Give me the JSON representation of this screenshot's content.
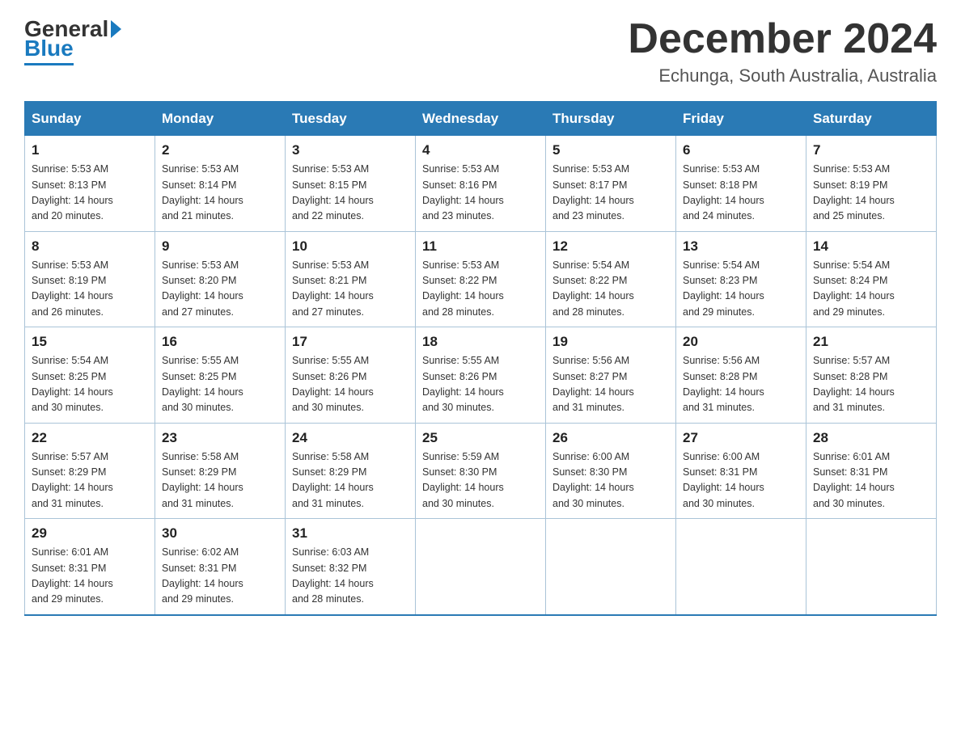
{
  "header": {
    "logo_general": "General",
    "logo_blue": "Blue",
    "month_title": "December 2024",
    "location": "Echunga, South Australia, Australia"
  },
  "weekdays": [
    "Sunday",
    "Monday",
    "Tuesday",
    "Wednesday",
    "Thursday",
    "Friday",
    "Saturday"
  ],
  "weeks": [
    [
      {
        "num": "1",
        "sunrise": "5:53 AM",
        "sunset": "8:13 PM",
        "daylight": "14 hours and 20 minutes."
      },
      {
        "num": "2",
        "sunrise": "5:53 AM",
        "sunset": "8:14 PM",
        "daylight": "14 hours and 21 minutes."
      },
      {
        "num": "3",
        "sunrise": "5:53 AM",
        "sunset": "8:15 PM",
        "daylight": "14 hours and 22 minutes."
      },
      {
        "num": "4",
        "sunrise": "5:53 AM",
        "sunset": "8:16 PM",
        "daylight": "14 hours and 23 minutes."
      },
      {
        "num": "5",
        "sunrise": "5:53 AM",
        "sunset": "8:17 PM",
        "daylight": "14 hours and 23 minutes."
      },
      {
        "num": "6",
        "sunrise": "5:53 AM",
        "sunset": "8:18 PM",
        "daylight": "14 hours and 24 minutes."
      },
      {
        "num": "7",
        "sunrise": "5:53 AM",
        "sunset": "8:19 PM",
        "daylight": "14 hours and 25 minutes."
      }
    ],
    [
      {
        "num": "8",
        "sunrise": "5:53 AM",
        "sunset": "8:19 PM",
        "daylight": "14 hours and 26 minutes."
      },
      {
        "num": "9",
        "sunrise": "5:53 AM",
        "sunset": "8:20 PM",
        "daylight": "14 hours and 27 minutes."
      },
      {
        "num": "10",
        "sunrise": "5:53 AM",
        "sunset": "8:21 PM",
        "daylight": "14 hours and 27 minutes."
      },
      {
        "num": "11",
        "sunrise": "5:53 AM",
        "sunset": "8:22 PM",
        "daylight": "14 hours and 28 minutes."
      },
      {
        "num": "12",
        "sunrise": "5:54 AM",
        "sunset": "8:22 PM",
        "daylight": "14 hours and 28 minutes."
      },
      {
        "num": "13",
        "sunrise": "5:54 AM",
        "sunset": "8:23 PM",
        "daylight": "14 hours and 29 minutes."
      },
      {
        "num": "14",
        "sunrise": "5:54 AM",
        "sunset": "8:24 PM",
        "daylight": "14 hours and 29 minutes."
      }
    ],
    [
      {
        "num": "15",
        "sunrise": "5:54 AM",
        "sunset": "8:25 PM",
        "daylight": "14 hours and 30 minutes."
      },
      {
        "num": "16",
        "sunrise": "5:55 AM",
        "sunset": "8:25 PM",
        "daylight": "14 hours and 30 minutes."
      },
      {
        "num": "17",
        "sunrise": "5:55 AM",
        "sunset": "8:26 PM",
        "daylight": "14 hours and 30 minutes."
      },
      {
        "num": "18",
        "sunrise": "5:55 AM",
        "sunset": "8:26 PM",
        "daylight": "14 hours and 30 minutes."
      },
      {
        "num": "19",
        "sunrise": "5:56 AM",
        "sunset": "8:27 PM",
        "daylight": "14 hours and 31 minutes."
      },
      {
        "num": "20",
        "sunrise": "5:56 AM",
        "sunset": "8:28 PM",
        "daylight": "14 hours and 31 minutes."
      },
      {
        "num": "21",
        "sunrise": "5:57 AM",
        "sunset": "8:28 PM",
        "daylight": "14 hours and 31 minutes."
      }
    ],
    [
      {
        "num": "22",
        "sunrise": "5:57 AM",
        "sunset": "8:29 PM",
        "daylight": "14 hours and 31 minutes."
      },
      {
        "num": "23",
        "sunrise": "5:58 AM",
        "sunset": "8:29 PM",
        "daylight": "14 hours and 31 minutes."
      },
      {
        "num": "24",
        "sunrise": "5:58 AM",
        "sunset": "8:29 PM",
        "daylight": "14 hours and 31 minutes."
      },
      {
        "num": "25",
        "sunrise": "5:59 AM",
        "sunset": "8:30 PM",
        "daylight": "14 hours and 30 minutes."
      },
      {
        "num": "26",
        "sunrise": "6:00 AM",
        "sunset": "8:30 PM",
        "daylight": "14 hours and 30 minutes."
      },
      {
        "num": "27",
        "sunrise": "6:00 AM",
        "sunset": "8:31 PM",
        "daylight": "14 hours and 30 minutes."
      },
      {
        "num": "28",
        "sunrise": "6:01 AM",
        "sunset": "8:31 PM",
        "daylight": "14 hours and 30 minutes."
      }
    ],
    [
      {
        "num": "29",
        "sunrise": "6:01 AM",
        "sunset": "8:31 PM",
        "daylight": "14 hours and 29 minutes."
      },
      {
        "num": "30",
        "sunrise": "6:02 AM",
        "sunset": "8:31 PM",
        "daylight": "14 hours and 29 minutes."
      },
      {
        "num": "31",
        "sunrise": "6:03 AM",
        "sunset": "8:32 PM",
        "daylight": "14 hours and 28 minutes."
      },
      null,
      null,
      null,
      null
    ]
  ],
  "labels": {
    "sunrise": "Sunrise:",
    "sunset": "Sunset:",
    "daylight": "Daylight:"
  }
}
